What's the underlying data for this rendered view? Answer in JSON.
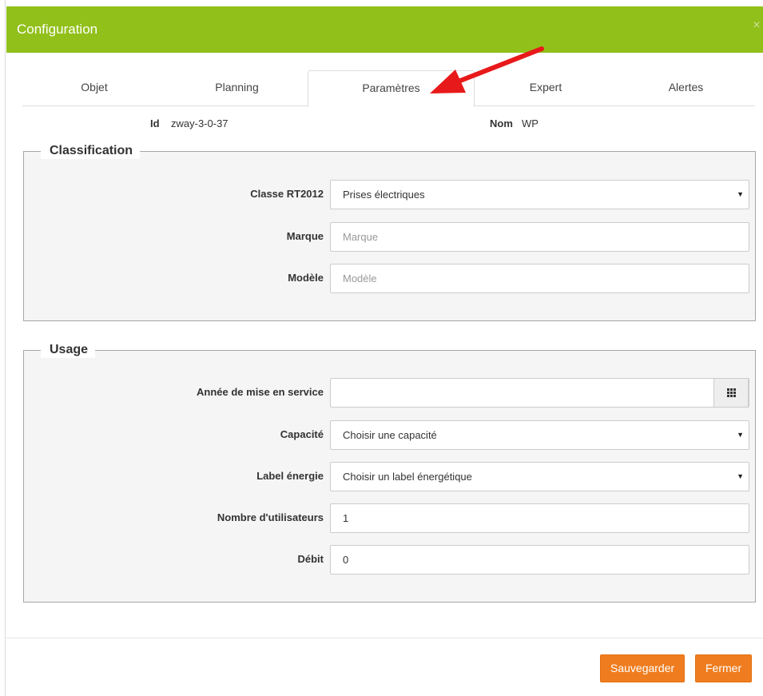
{
  "modal": {
    "title": "Configuration",
    "close_symbol": "×"
  },
  "tabs": [
    {
      "label": "Objet",
      "active": false
    },
    {
      "label": "Planning",
      "active": false
    },
    {
      "label": "Paramètres",
      "active": true
    },
    {
      "label": "Expert",
      "active": false
    },
    {
      "label": "Alertes",
      "active": false
    }
  ],
  "info": {
    "id_label": "Id",
    "id_value": "zway-3-0-37",
    "nom_label": "Nom",
    "nom_value": "WP"
  },
  "classification": {
    "legend": "Classification",
    "classe_label": "Classe RT2012",
    "classe_value": "Prises électriques",
    "marque_label": "Marque",
    "marque_placeholder": "Marque",
    "modele_label": "Modèle",
    "modele_placeholder": "Modèle"
  },
  "usage": {
    "legend": "Usage",
    "annee_label": "Année de mise en service",
    "annee_value": "",
    "capacite_label": "Capacité",
    "capacite_value": "Choisir une capacité",
    "label_energie_label": "Label énergie",
    "label_energie_value": "Choisir un label énergétique",
    "nb_users_label": "Nombre d'utilisateurs",
    "nb_users_value": "1",
    "debit_label": "Débit",
    "debit_value": "0"
  },
  "footer": {
    "save_label": "Sauvegarder",
    "close_label": "Fermer"
  },
  "colors": {
    "header": "#91c01a",
    "buttons": "#ef7d1f",
    "annotation_arrow": "#e8191a"
  },
  "icons": {
    "select": "caret-down-icon",
    "calendar": "grid-icon",
    "close": "close-icon"
  }
}
